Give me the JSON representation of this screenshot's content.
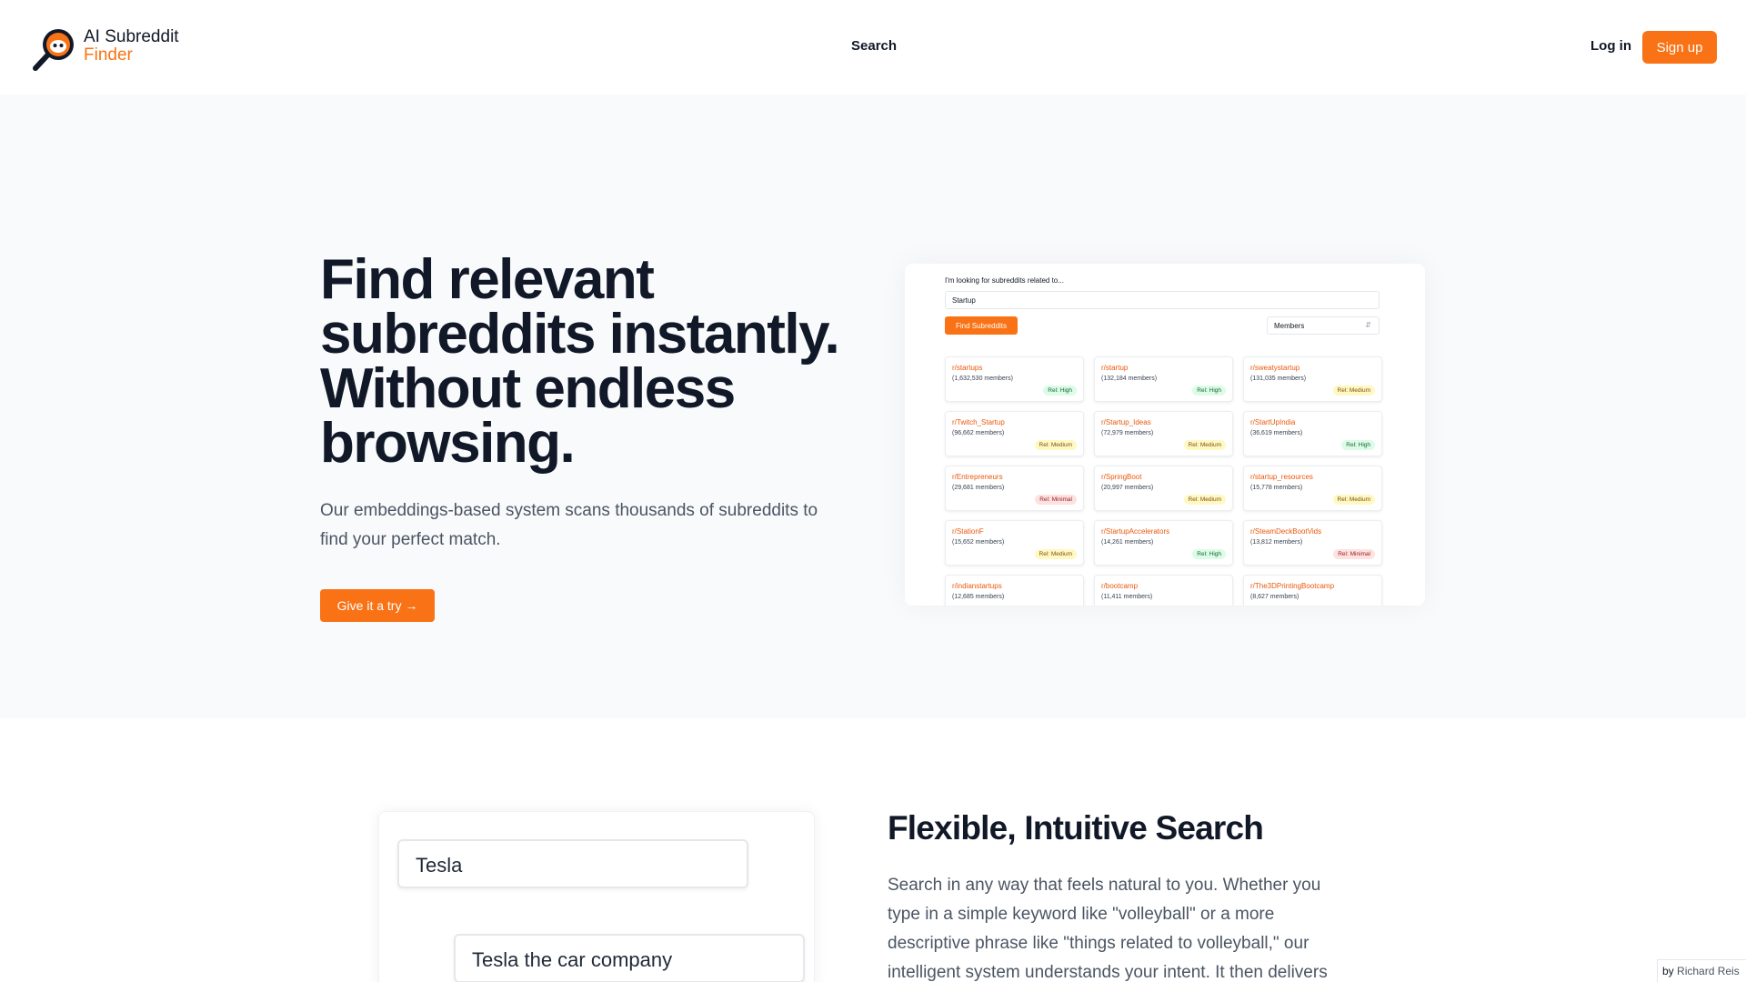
{
  "brand": {
    "line1": "AI Subreddit",
    "line2": "Finder"
  },
  "nav": {
    "search": "Search",
    "login": "Log in",
    "signup": "Sign up"
  },
  "hero": {
    "title_lines": [
      "Find relevant",
      "subreddits instantly.",
      "Without endless",
      "browsing."
    ],
    "subtitle": "Our embeddings-based system scans thousands of subreddits to find your perfect match.",
    "cta": "Give it a try →"
  },
  "preview": {
    "label": "I'm looking for subreddits related to...",
    "input_value": "Startup",
    "button": "Find Subreddits",
    "sort_value": "Members",
    "results": [
      {
        "name": "r/startups",
        "members": "(1,632,530 members)",
        "relevance": "Rel: High",
        "level": "high"
      },
      {
        "name": "r/startup",
        "members": "(132,184 members)",
        "relevance": "Rel: High",
        "level": "high"
      },
      {
        "name": "r/sweatystartup",
        "members": "(131,035 members)",
        "relevance": "Rel: Medium",
        "level": "medium"
      },
      {
        "name": "r/Twitch_Startup",
        "members": "(96,662 members)",
        "relevance": "Rel: Medium",
        "level": "medium"
      },
      {
        "name": "r/Startup_Ideas",
        "members": "(72,979 members)",
        "relevance": "Rel: Medium",
        "level": "medium"
      },
      {
        "name": "r/StartUpIndia",
        "members": "(36,619 members)",
        "relevance": "Rel: High",
        "level": "high"
      },
      {
        "name": "r/Entrepreneurs",
        "members": "(29,681 members)",
        "relevance": "Rel: Minimal",
        "level": "minimal"
      },
      {
        "name": "r/SpringBoot",
        "members": "(20,997 members)",
        "relevance": "Rel: Medium",
        "level": "medium"
      },
      {
        "name": "r/startup_resources",
        "members": "(15,778 members)",
        "relevance": "Rel: Medium",
        "level": "medium"
      },
      {
        "name": "r/StationF",
        "members": "(15,652 members)",
        "relevance": "Rel: Medium",
        "level": "medium"
      },
      {
        "name": "r/StartupAccelerators",
        "members": "(14,261 members)",
        "relevance": "Rel: High",
        "level": "high"
      },
      {
        "name": "r/SteamDeckBootVids",
        "members": "(13,812 members)",
        "relevance": "Rel: Minimal",
        "level": "minimal"
      },
      {
        "name": "r/indianstartups",
        "members": "(12,685 members)",
        "relevance": "",
        "level": ""
      },
      {
        "name": "r/bootcamp",
        "members": "(11,411 members)",
        "relevance": "",
        "level": ""
      },
      {
        "name": "r/The3DPrintingBootcamp",
        "members": "(8,627 members)",
        "relevance": "",
        "level": ""
      }
    ]
  },
  "feature": {
    "demo_input_1": "Tesla",
    "demo_input_2": "Tesla the car company",
    "title": "Flexible, Intuitive Search",
    "body": "Search in any way that feels natural to you. Whether you type in a simple keyword like \"volleyball\" or a more descriptive phrase like \"things related to volleyball,\" our intelligent system understands your intent. It then delivers"
  },
  "credit": {
    "by": "by",
    "name": "Richard Reis"
  },
  "colors": {
    "accent": "#f97316",
    "heading": "#111827",
    "body_text": "#4b5563"
  },
  "icons": {
    "logo": "magnifier-reddit-icon",
    "select": "chevron-up-down-icon"
  }
}
